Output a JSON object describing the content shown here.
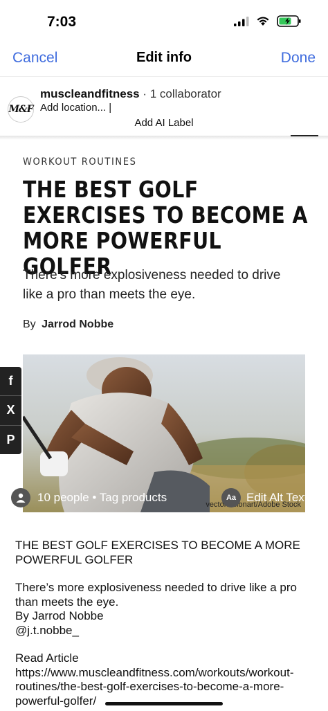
{
  "status": {
    "time": "7:03"
  },
  "nav": {
    "cancel": "Cancel",
    "title": "Edit info",
    "done": "Done"
  },
  "account": {
    "avatar_text": "M&F",
    "name": "muscleandfitness",
    "collaborator": " · 1 collaborator",
    "location": "Add location... |",
    "ai_label": "Add AI Label"
  },
  "article": {
    "kicker": "WORKOUT ROUTINES",
    "headline": "THE BEST GOLF EXERCISES TO BECOME A MORE POWERFUL GOLFER",
    "subhead": "There’s more explosiveness needed to drive like a pro than meets the eye.",
    "by": "By",
    "author": "Jarrod Nobbe",
    "photo_credit": "vectorfusionart/Adobe Stock"
  },
  "share": {
    "facebook": "f",
    "x": "X",
    "pinterest": "P"
  },
  "overlay": {
    "tag_text": "10 people • Tag products",
    "aa": "Aa",
    "alt_text": "Edit Alt Text"
  },
  "description": {
    "line1": "THE BEST GOLF EXERCISES TO BECOME A MORE POWERFUL GOLFER",
    "line2": "There’s more explosiveness needed to drive like a pro than meets the eye.",
    "line3": "By Jarrod Nobbe",
    "line4": "@j.t.nobbe_",
    "line5": "Read Article",
    "line6": "https://www.muscleandfitness.com/workouts/workout-routines/the-best-golf-exercises-to-become-a-more-powerful-golfer/"
  },
  "colors": {
    "accent": "#3f6cde"
  }
}
